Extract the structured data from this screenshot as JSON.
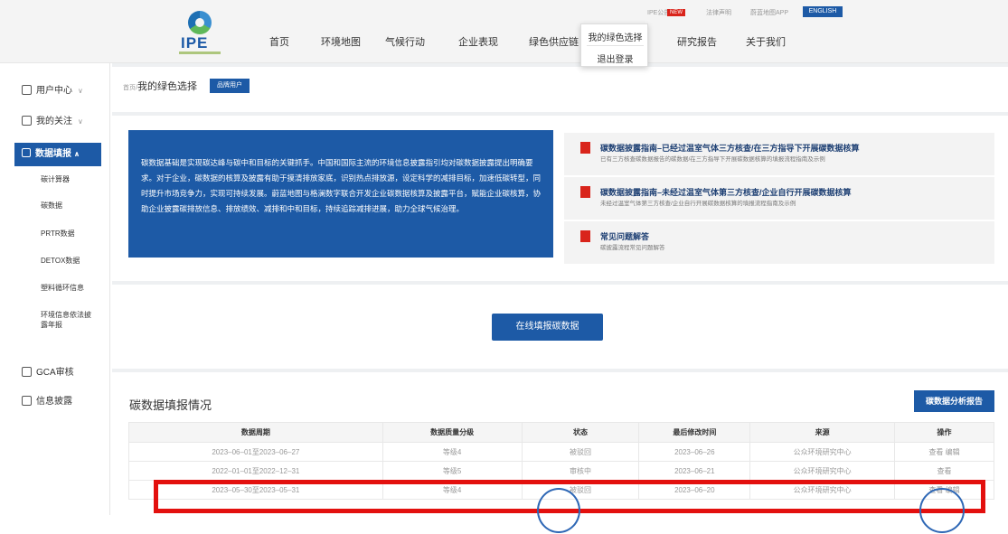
{
  "header": {
    "logo_text": "IPE",
    "utility": {
      "notice": "IPE公告",
      "new_badge": "NEW",
      "legal": "法律声明",
      "app": "蔚蓝地图APP",
      "english": "ENGLISH"
    },
    "nav": [
      "首页",
      "环境地图",
      "气候行动",
      "企业表现",
      "绿色供应链",
      "研究报告",
      "关于我们"
    ],
    "dropdown": [
      "我的绿色选择",
      "退出登录"
    ]
  },
  "sidebar": {
    "user_center": "用户中心",
    "my_follow": "我的关注",
    "data_report": "数据填报",
    "sub_items": [
      "碳计算器",
      "碳数据",
      "PRTR数据",
      "DETOX数据",
      "塑料循环信息",
      "环境信息依法披露年报"
    ],
    "gca": "GCA审核",
    "info_disclosure": "信息披露"
  },
  "breadcrumb": {
    "home": "首页/",
    "current": "我的绿色选择",
    "badge": "品牌用户"
  },
  "intro_text": "碳数据基础是实现碳达峰与碳中和目标的关键抓手。中国和国际主流的环境信息披露指引均对碳数据披露提出明确要求。对于企业，碳数据的核算及披露有助于摸清排放家底，识别热点排放源，设定科学的减排目标，加速低碳转型，同时提升市场竞争力，实现可持续发展。蔚蓝地图与格澜数字联合开发企业碳数据核算及披露平台，赋能企业碳核算，协助企业披露碳排放信息、排放绩效、减排和中和目标，持续追踪减排进展，助力全球气候治理。",
  "docs": [
    {
      "title": "碳数据披露指南–已经过温室气体三方核查/在三方指导下开展碳数据核算",
      "subtitle": "已有三方核查碳数据报告的碳数据/在三方指导下开展碳数据核算的填报流程指南及示例"
    },
    {
      "title": "碳数据披露指南–未经过温室气体第三方核查/企业自行开展碳数据核算",
      "subtitle": "未经过温室气体第三方核查/企业自行开展碳数据核算的填报流程指南及示例"
    },
    {
      "title": "常见问题解答",
      "subtitle": "碳披露流程常见问题解答"
    }
  ],
  "online_button": "在线填报碳数据",
  "section_title": "碳数据填报情况",
  "analysis_button": "碳数据分析报告",
  "table": {
    "headers": [
      "数据周期",
      "数据质量分级",
      "状态",
      "最后修改时间",
      "来源",
      "操作"
    ],
    "rows": [
      {
        "period": "2023–06–01至2023–06–27",
        "grade": "等级4",
        "status": "被驳回",
        "modified": "2023–06–26",
        "source": "公众环境研究中心",
        "ops": "查看 编辑"
      },
      {
        "period": "2022–01–01至2022–12–31",
        "grade": "等级5",
        "status": "审核中",
        "modified": "2023–06–21",
        "source": "公众环境研究中心",
        "ops": "查看"
      },
      {
        "period": "2023–05–30至2023–05–31",
        "grade": "等级4",
        "status": "被驳回",
        "modified": "2023–06–20",
        "source": "公众环境研究中心",
        "ops": "查看 编辑"
      }
    ]
  },
  "colors": {
    "brand": "#1d5aa6",
    "highlight": "#e3100e",
    "annotation": "#2e67b5"
  }
}
